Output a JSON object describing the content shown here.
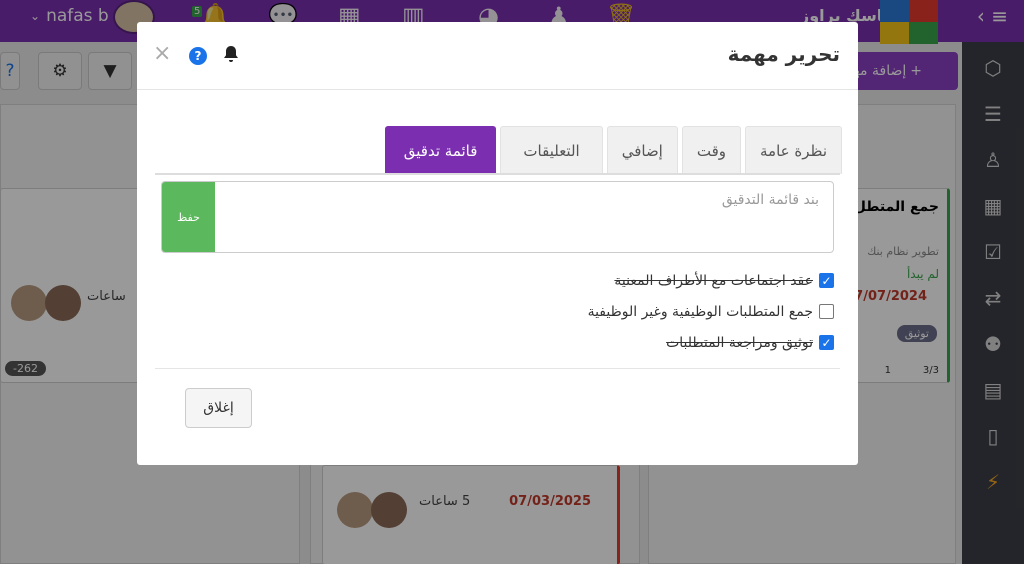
{
  "topbar": {
    "user_name": "nafas b",
    "brand": "تاسك براوز",
    "badge_count": "5",
    "colors": {
      "bar": "#7b2fb0",
      "accent": "#8b3ec4"
    }
  },
  "background": {
    "add_task_label": "إضافة مهمة",
    "card_left": {
      "hours": "ساعات",
      "badge": "-262"
    },
    "card_right": {
      "title": "جمع المتطل",
      "subtitle": "تطوير نظام بنك",
      "status": "لم يبدأ",
      "date": "07/07/2024",
      "tag": "توثيق",
      "comments": "1",
      "checks": "3/3"
    },
    "card_bottom": {
      "date": "07/03/2025",
      "hours": "5 ساعات"
    }
  },
  "modal": {
    "title": "تحرير مهمة",
    "close_symbol": "×",
    "help_symbol": "?",
    "tabs": [
      {
        "label": "نظرة عامة",
        "active": false
      },
      {
        "label": "وقت",
        "active": false
      },
      {
        "label": "إضافي",
        "active": false
      },
      {
        "label": "التعليقات",
        "active": false
      },
      {
        "label": "قائمة تدقيق",
        "active": true
      }
    ],
    "item_input": {
      "placeholder": "بند قائمة التدقيق",
      "value": ""
    },
    "save_label": "حفظ",
    "checklist": [
      {
        "label": "عقد اجتماعات مع الأطراف المعنية",
        "checked": true
      },
      {
        "label": "جمع المتطلبات الوظيفية وغير الوظيفية",
        "checked": false
      },
      {
        "label": "توثيق ومراجعة المتطلبات",
        "checked": true
      }
    ],
    "close_label": "إغلاق"
  },
  "icons": {
    "toolbar": [
      "help-icon",
      "gear-icon",
      "filter-icon"
    ],
    "sidebar": [
      "cubes-icon",
      "list-icon",
      "user-icon",
      "table-icon",
      "calendar-check-icon",
      "exchange-icon",
      "users-icon",
      "form-icon",
      "file-icon",
      "magic-icon"
    ]
  }
}
